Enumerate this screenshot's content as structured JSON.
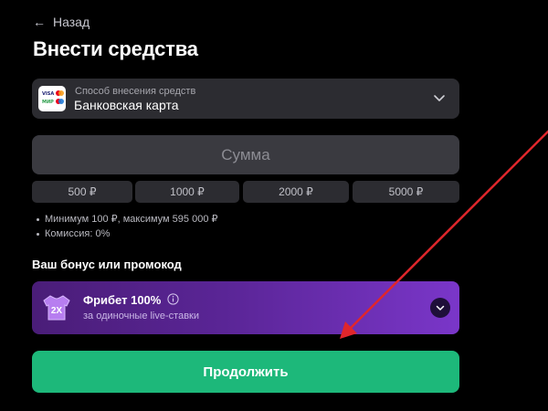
{
  "nav": {
    "back_label": "Назад"
  },
  "page": {
    "title": "Внести средства"
  },
  "payment_method": {
    "caption": "Способ внесения средств",
    "value": "Банковская карта",
    "logo_text_top": "VISA",
    "logo_text_bottom": "МИР"
  },
  "amount": {
    "placeholder": "Сумма"
  },
  "presets": [
    "500 ₽",
    "1000 ₽",
    "2000 ₽",
    "5000 ₽"
  ],
  "limits": [
    "Минимум 100 ₽, максимум 595 000 ₽",
    "Комиссия: 0%"
  ],
  "bonus": {
    "section_label": "Ваш бонус или промокод",
    "name": "Фрибет 100%",
    "description": "за одиночные live-ставки",
    "badge_text": "2X"
  },
  "actions": {
    "continue_label": "Продолжить"
  },
  "colors": {
    "background": "#000000",
    "surface": "#2c2c31",
    "accent_green": "#1db87a",
    "bonus_purple": "#7a36c9",
    "annotation_arrow": "#e0262b"
  }
}
